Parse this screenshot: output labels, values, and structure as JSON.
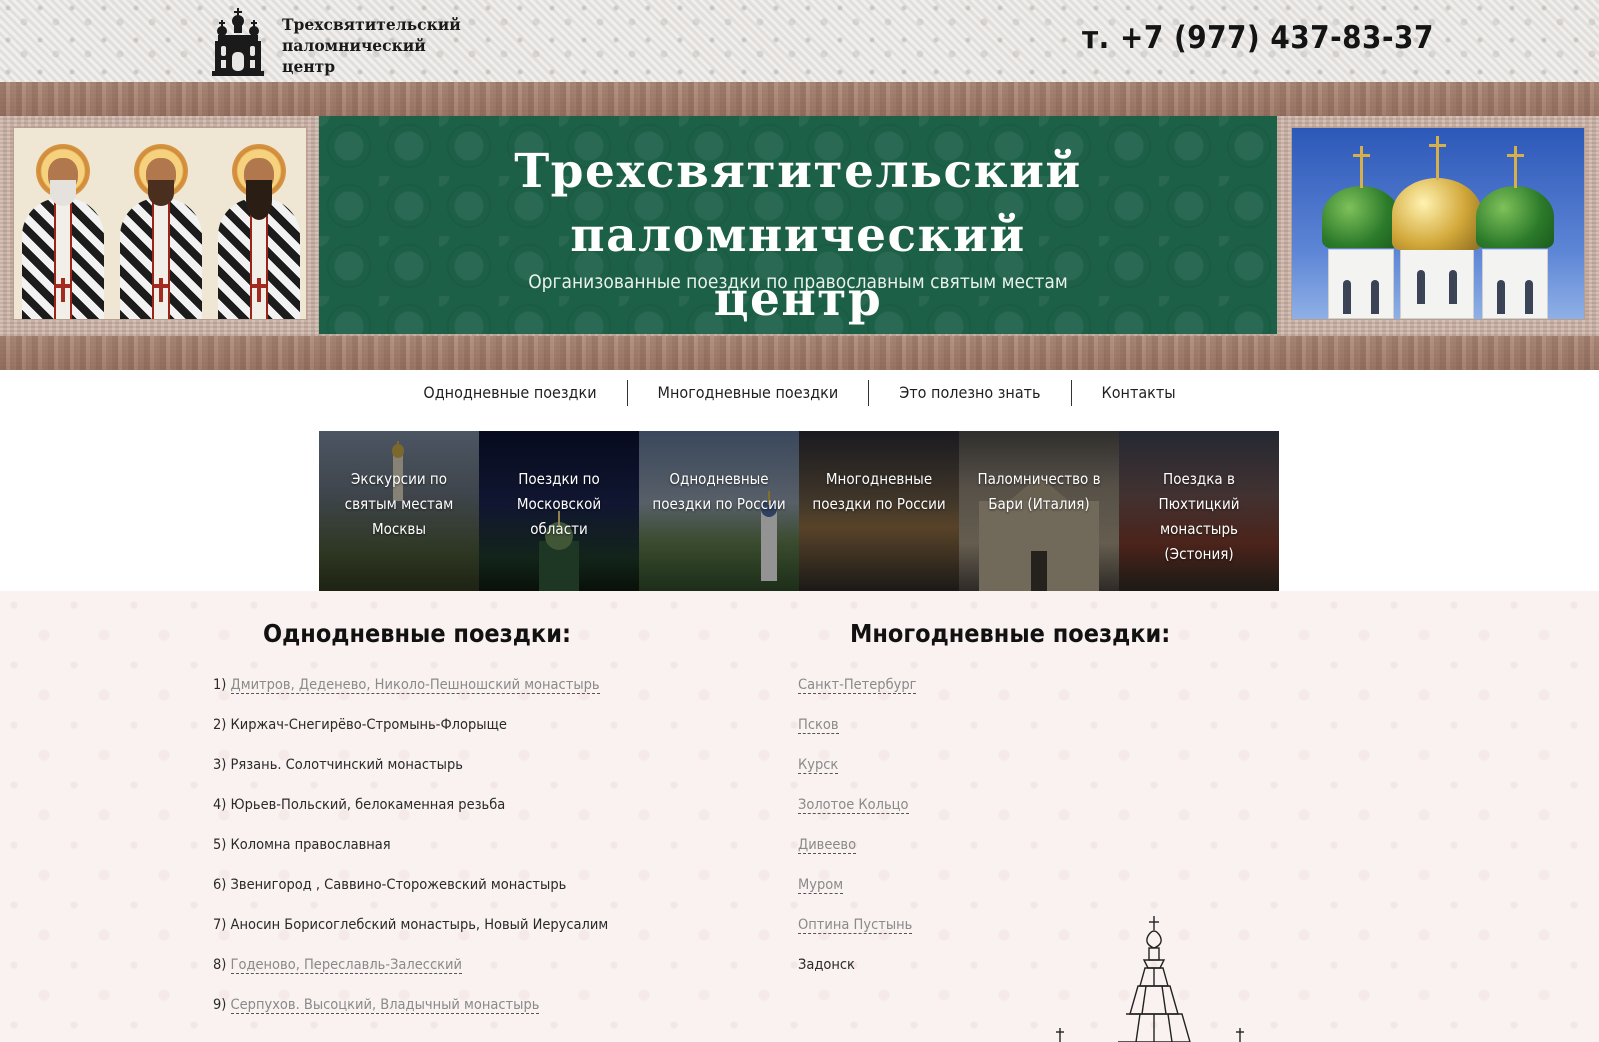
{
  "header": {
    "logo_lines": [
      "Трехсвятительский",
      "паломнический",
      "центр"
    ],
    "phone": "т. +7 (977) 437-83-37"
  },
  "banner": {
    "title_line1": "Трехсвятительский паломнический",
    "title_line2": "центр",
    "subtitle": "Организованные поездки по православным святым местам"
  },
  "nav": {
    "items": [
      {
        "label": "Однодневные поездки"
      },
      {
        "label": "Многодневные поездки"
      },
      {
        "label": "Это полезно знать"
      },
      {
        "label": "Контакты"
      }
    ]
  },
  "tiles": [
    {
      "label": "Экскурсии по святым местам Москвы"
    },
    {
      "label": "Поездки по Московской области"
    },
    {
      "label": "Однодневные поездки по России"
    },
    {
      "label": "Многодневные поездки по России"
    },
    {
      "label": "Паломничество в Бари (Италия)"
    },
    {
      "label": "Поездка в Пюхтицкий монастырь (Эстония)"
    }
  ],
  "one_day": {
    "title": "Однодневные поездки:",
    "items": [
      {
        "num": "1) ",
        "text": "Дмитров, Деденево, Николо-Пешношский монастырь",
        "link": true
      },
      {
        "num": "2) ",
        "text": "Киржач-Снегирёво-Стромынь-Флорыще",
        "link": false
      },
      {
        "num": "3) ",
        "text": "Рязань. Солотчинский монастырь",
        "link": false
      },
      {
        "num": "4) ",
        "text": "Юрьев-Польский, белокаменная резьба",
        "link": false
      },
      {
        "num": "5) ",
        "text": "Коломна православная",
        "link": false
      },
      {
        "num": "6) ",
        "text": "Звенигород , Саввино-Сторожевский монастырь",
        "link": false
      },
      {
        "num": "7) ",
        "text": "Аносин Борисоглебский монастырь, Новый Иерусалим",
        "link": false
      },
      {
        "num": "8) ",
        "text": "Годеново, Переславль-Залесский",
        "link": true
      },
      {
        "num": "9) ",
        "text": "Серпухов. Высоцкий, Владычный монастырь",
        "link": true
      }
    ]
  },
  "multi_day": {
    "title": "Многодневные поездки:",
    "items": [
      {
        "text": "Санкт-Петербург",
        "link": true
      },
      {
        "text": "Псков",
        "link": true
      },
      {
        "text": "Курск",
        "link": true
      },
      {
        "text": "Золотое Кольцо",
        "link": true
      },
      {
        "text": "Дивеево",
        "link": true
      },
      {
        "text": "Муром",
        "link": true
      },
      {
        "text": "Оптина Пустынь",
        "link": true
      },
      {
        "text": "Задонск",
        "link": false
      }
    ]
  },
  "icons": {
    "logo": "church-logo-icon",
    "church_drawing": "church-sketch-icon"
  },
  "colors": {
    "banner_green": "#1d6048",
    "link_gray": "#8a8a8a"
  }
}
